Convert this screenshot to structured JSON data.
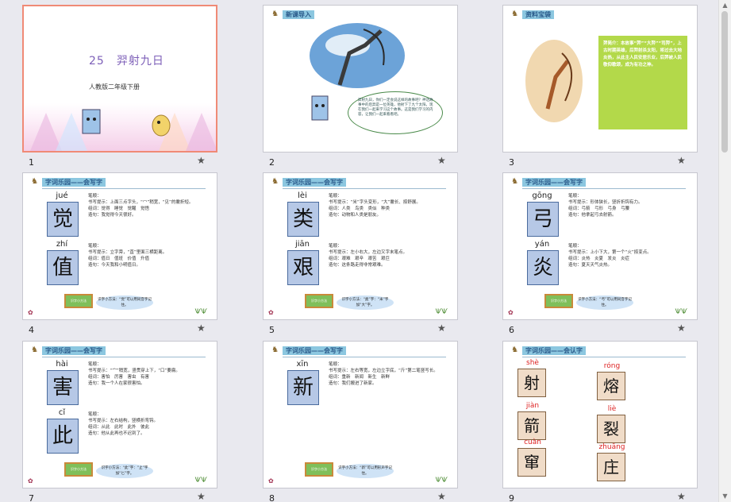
{
  "slides": [
    {
      "num": "1",
      "title": "25　羿射九日",
      "subtitle": "人教版二年级下册"
    },
    {
      "num": "2",
      "header": "新课导入",
      "bubble_text": "羿射九日，你们一定会说这样的故事吧？神话故事中的后羿是一位英雄，他射下了九个太阳。现在我们一起来学习这个故事。这是我们学习的内容，让我们一起来看看吧。"
    },
    {
      "num": "3",
      "header": "资料宝袋",
      "info": "羿简介：本故事“羿”“大羿”“司羿”，上古时期英雄，后羿射杀太阳，将过去大地炎热，从此主人民安居乐业，后羿被人民敬仰歌颂，成为有功之神。"
    },
    {
      "num": "4",
      "header": "字词乐园——会写字",
      "chars": [
        {
          "py": "jué",
          "ch": "觉"
        },
        {
          "py": "zhí",
          "ch": "值"
        }
      ],
      "lines_a": [
        "笔顺：",
        "书写提示：上面三点字头，“冖”稍宽，“见”的撇折短。",
        "组词：觉得　睡觉　觉醒　觉悟",
        "造句：我觉得今天很好。"
      ],
      "lines_b": [
        "笔顺：",
        "书写提示：立字旁，“直”里面三横距离。",
        "组词：值日　值班　价值　升值",
        "造句：今天我和小明值日。"
      ],
      "sign": "识字小方法",
      "tip": "识字小方法：“觉”可以用同音字记住。"
    },
    {
      "num": "5",
      "header": "字词乐园——会写字",
      "chars": [
        {
          "py": "lèi",
          "ch": "类"
        },
        {
          "py": "jiān",
          "ch": "艰"
        }
      ],
      "lines_a": [
        "笔顺：",
        "书写提示：“米”字头变形，“大”撇长、捺舒展。",
        "组词：人类　鸟类　类似　种类",
        "造句：动物和人类是朋友。"
      ],
      "lines_b": [
        "笔顺：",
        "书写提示：左小右大，左边又字末笔点。",
        "组词：艰难　艰辛　艰苦　艰巨",
        "造句：这条路走得非常艰难。"
      ],
      "sign": "识字小方法",
      "tip": "识字小方法：“类”字：“米”字加“大”字。"
    },
    {
      "num": "6",
      "header": "字词乐园——会写字",
      "chars": [
        {
          "py": "gōng",
          "ch": "弓"
        },
        {
          "py": "yán",
          "ch": "炎"
        }
      ],
      "lines_a": [
        "笔顺：",
        "书写提示：形体狭长，竖折折钩有力。",
        "组词：弓箭　弓形　弓身　弓腰",
        "造句：他拿起弓去射箭。"
      ],
      "lines_b": [
        "笔顺：",
        "书写提示：上小下大，第一个“火”捺变点。",
        "组词：炎热　炎夏　发炎　炎症",
        "造句：夏天天气炎热。"
      ],
      "sign": "识字小方法",
      "tip": "识字小方法：“弓”可以用同音字记住。"
    },
    {
      "num": "7",
      "header": "字词乐园——会写字",
      "chars": [
        {
          "py": "hài",
          "ch": "害"
        },
        {
          "py": "cǐ",
          "ch": "此"
        }
      ],
      "lines_a": [
        "笔顺：",
        "书写提示：“宀”稍宽，竖贯穿上下，“口”要扁。",
        "组词：害怕　厉害　害虫　有害",
        "造句：我一个人在家很害怕。"
      ],
      "lines_b": [
        "笔顺：",
        "书写提示：左右结构，竖横折弯钩。",
        "组词：从此　此时　此外　彼此",
        "造句：他从此再也不迟到了。"
      ],
      "sign": "识字小方法",
      "tip": "识字小方法：“此”字：“止”字加“匕”字。"
    },
    {
      "num": "8",
      "header": "字词乐园——会写字",
      "chars": [
        {
          "py": "xīn",
          "ch": "新"
        }
      ],
      "lines_a": [
        "笔顺：",
        "书写提示：左右等宽，左边立字底，“斤”第二笔竖写长。",
        "组词：重新　新闻　新生　新鲜",
        "造句：我们搬进了新家。"
      ],
      "sign": "识字小方法",
      "tip": "识字小方法：“新”可以用形声字记住。"
    },
    {
      "num": "9",
      "header": "字词乐园——会认字",
      "chars": [
        {
          "py": "shè",
          "ch": "射"
        },
        {
          "py": "róng",
          "ch": "熔"
        },
        {
          "py": "jiàn",
          "ch": "箭"
        },
        {
          "py": "liè",
          "ch": "裂"
        },
        {
          "py": "cuàn",
          "ch": "窜"
        },
        {
          "py": "zhuāng",
          "ch": "庄"
        }
      ]
    }
  ]
}
